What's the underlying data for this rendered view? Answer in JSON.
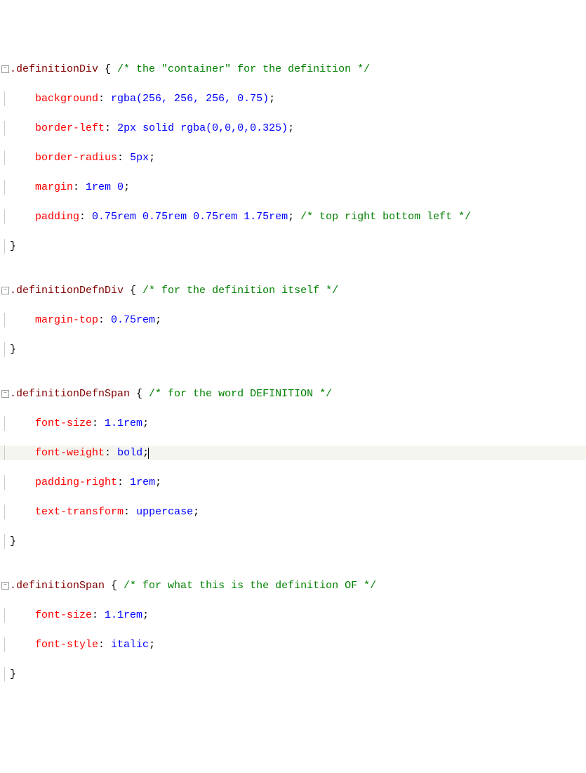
{
  "lines": [
    {
      "fold": true,
      "highlight": false,
      "tokens": [
        {
          "cls": "sel",
          "t": ".definitionDiv "
        },
        {
          "cls": "punc",
          "t": "{ "
        },
        {
          "cls": "comment",
          "t": "/* the \"container\" for the definition */"
        }
      ]
    },
    {
      "fold": false,
      "highlight": false,
      "tokens": [
        {
          "cls": "punc",
          "t": "    "
        },
        {
          "cls": "prop",
          "t": "background"
        },
        {
          "cls": "punc",
          "t": ": "
        },
        {
          "cls": "val",
          "t": "rgba(256, 256, 256, 0.75)"
        },
        {
          "cls": "punc",
          "t": ";"
        }
      ]
    },
    {
      "fold": false,
      "highlight": false,
      "tokens": [
        {
          "cls": "punc",
          "t": "    "
        },
        {
          "cls": "prop",
          "t": "border-left"
        },
        {
          "cls": "punc",
          "t": ": "
        },
        {
          "cls": "val",
          "t": "2px solid rgba(0,0,0,0.325)"
        },
        {
          "cls": "punc",
          "t": ";"
        }
      ]
    },
    {
      "fold": false,
      "highlight": false,
      "tokens": [
        {
          "cls": "punc",
          "t": "    "
        },
        {
          "cls": "prop",
          "t": "border-radius"
        },
        {
          "cls": "punc",
          "t": ": "
        },
        {
          "cls": "val",
          "t": "5px"
        },
        {
          "cls": "punc",
          "t": ";"
        }
      ]
    },
    {
      "fold": false,
      "highlight": false,
      "tokens": [
        {
          "cls": "punc",
          "t": "    "
        },
        {
          "cls": "prop",
          "t": "margin"
        },
        {
          "cls": "punc",
          "t": ": "
        },
        {
          "cls": "val",
          "t": "1rem 0"
        },
        {
          "cls": "punc",
          "t": ";"
        }
      ]
    },
    {
      "fold": false,
      "highlight": false,
      "tokens": [
        {
          "cls": "punc",
          "t": "    "
        },
        {
          "cls": "prop",
          "t": "padding"
        },
        {
          "cls": "punc",
          "t": ": "
        },
        {
          "cls": "val",
          "t": "0.75rem 0.75rem 0.75rem 1.75rem"
        },
        {
          "cls": "punc",
          "t": "; "
        },
        {
          "cls": "comment",
          "t": "/* top right bottom left */"
        }
      ]
    },
    {
      "fold": false,
      "highlight": false,
      "tokens": [
        {
          "cls": "punc",
          "t": "}"
        }
      ]
    },
    {
      "fold": false,
      "highlight": false,
      "tokens": [
        {
          "cls": "punc",
          "t": ""
        }
      ]
    },
    {
      "fold": true,
      "highlight": false,
      "tokens": [
        {
          "cls": "sel",
          "t": ".definitionDefnDiv "
        },
        {
          "cls": "punc",
          "t": "{ "
        },
        {
          "cls": "comment",
          "t": "/* for the definition itself */"
        }
      ]
    },
    {
      "fold": false,
      "highlight": false,
      "tokens": [
        {
          "cls": "punc",
          "t": "    "
        },
        {
          "cls": "prop",
          "t": "margin-top"
        },
        {
          "cls": "punc",
          "t": ": "
        },
        {
          "cls": "val",
          "t": "0.75rem"
        },
        {
          "cls": "punc",
          "t": ";"
        }
      ]
    },
    {
      "fold": false,
      "highlight": false,
      "tokens": [
        {
          "cls": "punc",
          "t": "}"
        }
      ]
    },
    {
      "fold": false,
      "highlight": false,
      "tokens": [
        {
          "cls": "punc",
          "t": ""
        }
      ]
    },
    {
      "fold": true,
      "highlight": false,
      "tokens": [
        {
          "cls": "sel",
          "t": ".definitionDefnSpan "
        },
        {
          "cls": "punc",
          "t": "{ "
        },
        {
          "cls": "comment",
          "t": "/* for the word DEFINITION */"
        }
      ]
    },
    {
      "fold": false,
      "highlight": false,
      "tokens": [
        {
          "cls": "punc",
          "t": "    "
        },
        {
          "cls": "prop",
          "t": "font-size"
        },
        {
          "cls": "punc",
          "t": ": "
        },
        {
          "cls": "val",
          "t": "1.1rem"
        },
        {
          "cls": "punc",
          "t": ";"
        }
      ]
    },
    {
      "fold": false,
      "highlight": true,
      "cursor": true,
      "tokens": [
        {
          "cls": "punc",
          "t": "    "
        },
        {
          "cls": "prop",
          "t": "font-weight"
        },
        {
          "cls": "punc",
          "t": ": "
        },
        {
          "cls": "val",
          "t": "bold"
        },
        {
          "cls": "punc",
          "t": ";"
        }
      ]
    },
    {
      "fold": false,
      "highlight": false,
      "tokens": [
        {
          "cls": "punc",
          "t": "    "
        },
        {
          "cls": "prop",
          "t": "padding-right"
        },
        {
          "cls": "punc",
          "t": ": "
        },
        {
          "cls": "val",
          "t": "1rem"
        },
        {
          "cls": "punc",
          "t": ";"
        }
      ]
    },
    {
      "fold": false,
      "highlight": false,
      "tokens": [
        {
          "cls": "punc",
          "t": "    "
        },
        {
          "cls": "prop",
          "t": "text-transform"
        },
        {
          "cls": "punc",
          "t": ": "
        },
        {
          "cls": "val",
          "t": "uppercase"
        },
        {
          "cls": "punc",
          "t": ";"
        }
      ]
    },
    {
      "fold": false,
      "highlight": false,
      "tokens": [
        {
          "cls": "punc",
          "t": "}"
        }
      ]
    },
    {
      "fold": false,
      "highlight": false,
      "tokens": [
        {
          "cls": "punc",
          "t": ""
        }
      ]
    },
    {
      "fold": true,
      "highlight": false,
      "tokens": [
        {
          "cls": "sel",
          "t": ".definitionSpan "
        },
        {
          "cls": "punc",
          "t": "{ "
        },
        {
          "cls": "comment",
          "t": "/* for what this is the definition OF */"
        }
      ]
    },
    {
      "fold": false,
      "highlight": false,
      "tokens": [
        {
          "cls": "punc",
          "t": "    "
        },
        {
          "cls": "prop",
          "t": "font-size"
        },
        {
          "cls": "punc",
          "t": ": "
        },
        {
          "cls": "val",
          "t": "1.1rem"
        },
        {
          "cls": "punc",
          "t": ";"
        }
      ]
    },
    {
      "fold": false,
      "highlight": false,
      "tokens": [
        {
          "cls": "punc",
          "t": "    "
        },
        {
          "cls": "prop",
          "t": "font-style"
        },
        {
          "cls": "punc",
          "t": ": "
        },
        {
          "cls": "val",
          "t": "italic"
        },
        {
          "cls": "punc",
          "t": ";"
        }
      ]
    },
    {
      "fold": false,
      "highlight": false,
      "tokens": [
        {
          "cls": "punc",
          "t": "}"
        }
      ]
    }
  ]
}
